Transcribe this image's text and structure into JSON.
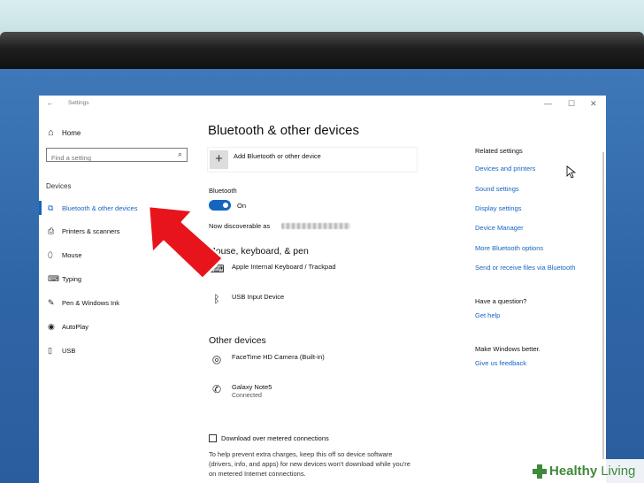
{
  "window": {
    "title": "Settings",
    "back_glyph": "←",
    "controls": {
      "minimize": "—",
      "maximize": "☐",
      "close": "✕"
    }
  },
  "nav": {
    "home_label": "Home",
    "search_placeholder": "Find a setting",
    "section_label": "Devices",
    "items": [
      {
        "label": "Bluetooth & other devices",
        "icon": "bluetooth-devices-icon",
        "glyph": "⧉"
      },
      {
        "label": "Printers & scanners",
        "icon": "printer-icon",
        "glyph": "⎙"
      },
      {
        "label": "Mouse",
        "icon": "mouse-icon",
        "glyph": "⬯"
      },
      {
        "label": "Typing",
        "icon": "keyboard-icon",
        "glyph": "⌨"
      },
      {
        "label": "Pen & Windows Ink",
        "icon": "pen-icon",
        "glyph": "✎"
      },
      {
        "label": "AutoPlay",
        "icon": "autoplay-icon",
        "glyph": "◉"
      },
      {
        "label": "USB",
        "icon": "usb-icon",
        "glyph": "▯"
      }
    ]
  },
  "main": {
    "title": "Bluetooth & other devices",
    "add_device_label": "Add Bluetooth or other device",
    "bluetooth_label": "Bluetooth",
    "toggle_state": "On",
    "discoverable_prefix": "Now discoverable as",
    "mouse_section_title": "Mouse, keyboard, & pen",
    "mouse_devices": [
      {
        "name": "Apple Internal Keyboard / Trackpad",
        "icon": "keyboard-icon",
        "glyph": "⌨"
      },
      {
        "name": "USB Input Device",
        "icon": "bluetooth-icon",
        "glyph": "ᛒ"
      }
    ],
    "other_section_title": "Other devices",
    "other_devices": [
      {
        "name": "FaceTime HD Camera (Built-in)",
        "status": "",
        "icon": "webcam-icon",
        "glyph": "◎"
      },
      {
        "name": "Galaxy Note5",
        "status": "Connected",
        "icon": "phone-icon",
        "glyph": "✆"
      }
    ],
    "metered_label": "Download over metered connections",
    "metered_desc": "To help prevent extra charges, keep this off so device software (drivers, info, and apps) for new devices won't download while you're on metered Internet connections."
  },
  "related": {
    "title": "Related settings",
    "links": [
      "Devices and printers",
      "Sound settings",
      "Display settings",
      "Device Manager",
      "More Bluetooth options",
      "Send or receive files via Bluetooth"
    ],
    "question_title": "Have a question?",
    "help_link": "Get help",
    "better_title": "Make Windows better.",
    "feedback_link": "Give us feedback"
  },
  "watermark": {
    "brand_bold": "Healthy",
    "brand_light": "Living"
  },
  "colors": {
    "accent": "#1565c0",
    "arrow": "#e8141c",
    "desktop": "#2f66a8"
  }
}
